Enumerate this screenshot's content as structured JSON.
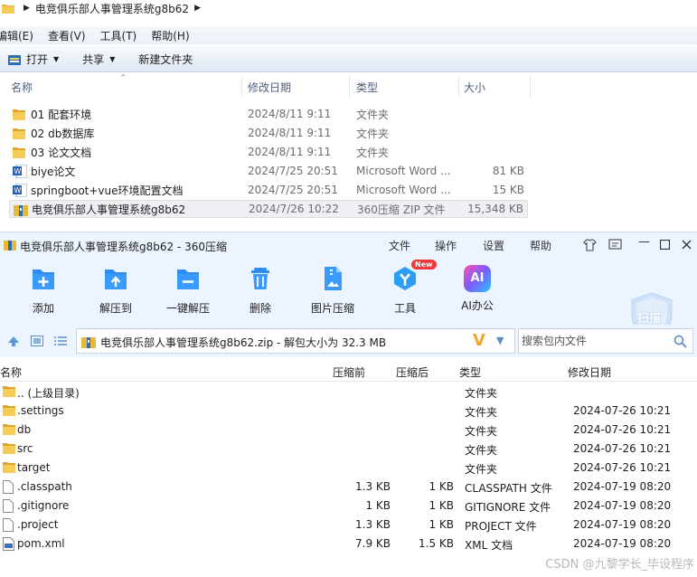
{
  "explorer": {
    "breadcrumb": "电竞俱乐部人事管理系统g8b62",
    "menu": [
      "编辑(E)",
      "查看(V)",
      "工具(T)",
      "帮助(H)"
    ],
    "toolbar": {
      "open": "打开",
      "share": "共享",
      "new_folder": "新建文件夹"
    },
    "columns": {
      "name": "名称",
      "date": "修改日期",
      "type": "类型",
      "size": "大小"
    },
    "rows": [
      {
        "icon": "folder-icon",
        "name": "01 配套环境",
        "date": "2024/8/11 9:11",
        "type": "文件夹",
        "size": ""
      },
      {
        "icon": "folder-icon",
        "name": "02 db数据库",
        "date": "2024/8/11 9:11",
        "type": "文件夹",
        "size": ""
      },
      {
        "icon": "folder-icon",
        "name": "03 论文文档",
        "date": "2024/8/11 9:11",
        "type": "文件夹",
        "size": ""
      },
      {
        "icon": "word-icon",
        "name": "biye论文",
        "date": "2024/7/25 20:51",
        "type": "Microsoft Word ...",
        "size": "81 KB"
      },
      {
        "icon": "word-icon",
        "name": "springboot+vue环境配置文档",
        "date": "2024/7/25 20:51",
        "type": "Microsoft Word ...",
        "size": "15 KB"
      },
      {
        "icon": "zip-icon",
        "name": "电竞俱乐部人事管理系统g8b62",
        "date": "2024/7/26 10:22",
        "type": "360压缩 ZIP 文件",
        "size": "15,348 KB"
      }
    ]
  },
  "zip": {
    "title": "电竞俱乐部人事管理系统g8b62 - 360压缩",
    "title_menu": [
      "文件",
      "操作",
      "设置",
      "帮助"
    ],
    "tools": [
      {
        "label": "添加",
        "icon": "add-icon"
      },
      {
        "label": "解压到",
        "icon": "extract-to-icon"
      },
      {
        "label": "一键解压",
        "icon": "one-click-extract-icon"
      },
      {
        "label": "删除",
        "icon": "delete-icon"
      },
      {
        "label": "图片压缩",
        "icon": "image-compress-icon"
      },
      {
        "label": "工具",
        "icon": "tools-icon"
      },
      {
        "label": "AI办公",
        "icon": "ai-office-icon"
      }
    ],
    "new_badge": "New",
    "ai_glyph": "AI",
    "scan": "扫描",
    "address": "电竞俱乐部人事管理系统g8b62.zip - 解包大小为 32.3 MB",
    "vip_glyph": "V",
    "search_placeholder": "搜索包内文件",
    "columns": {
      "name": "名称",
      "compressed": "压缩前",
      "after": "压缩后",
      "type": "类型",
      "date": "修改日期"
    },
    "rows": [
      {
        "icon": "folder-icon",
        "name": ".. (上级目录)",
        "before": "",
        "after": "",
        "type": "文件夹",
        "date": ""
      },
      {
        "icon": "folder-icon",
        "name": ".settings",
        "before": "",
        "after": "",
        "type": "文件夹",
        "date": "2024-07-26 10:21"
      },
      {
        "icon": "folder-icon",
        "name": "db",
        "before": "",
        "after": "",
        "type": "文件夹",
        "date": "2024-07-26 10:21"
      },
      {
        "icon": "folder-icon",
        "name": "src",
        "before": "",
        "after": "",
        "type": "文件夹",
        "date": "2024-07-26 10:21"
      },
      {
        "icon": "folder-icon",
        "name": "target",
        "before": "",
        "after": "",
        "type": "文件夹",
        "date": "2024-07-26 10:21"
      },
      {
        "icon": "file-icon",
        "name": ".classpath",
        "before": "1.3 KB",
        "after": "1 KB",
        "type": "CLASSPATH 文件",
        "date": "2024-07-19 08:20"
      },
      {
        "icon": "file-icon",
        "name": ".gitignore",
        "before": "1 KB",
        "after": "1 KB",
        "type": "GITIGNORE 文件",
        "date": "2024-07-19 08:20"
      },
      {
        "icon": "file-icon",
        "name": ".project",
        "before": "1.3 KB",
        "after": "1 KB",
        "type": "PROJECT 文件",
        "date": "2024-07-19 08:20"
      },
      {
        "icon": "xml-file-icon",
        "name": "pom.xml",
        "before": "7.9 KB",
        "after": "1.5 KB",
        "type": "XML 文档",
        "date": "2024-07-19 08:20"
      }
    ]
  },
  "watermark": "CSDN @九黎学长_毕设程序"
}
